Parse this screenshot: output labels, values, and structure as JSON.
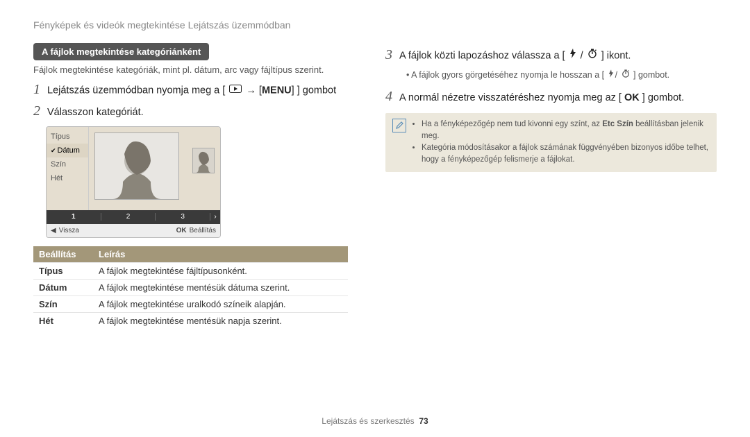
{
  "header": {
    "title": "Fényképek és videók megtekintése Lejátszás üzemmódban"
  },
  "left": {
    "section_title": "A fájlok megtekintése kategóriánként",
    "section_desc": "Fájlok megtekintése kategóriák, mint pl. dátum, arc vagy fájltípus szerint.",
    "step1_pre": "Lejátszás üzemmódban nyomja meg a [",
    "step1_post": "] gombot",
    "step2_text": "Válasszon kategóriát.",
    "screen": {
      "cats": {
        "typus": "Típus",
        "datum": "Dátum",
        "szin": "Szín",
        "het": "Hét"
      },
      "thumbs": {
        "n1": "1",
        "n2": "2",
        "n3": "3"
      },
      "status_back": "Vissza",
      "status_ok": "OK",
      "status_set": "Beállítás"
    },
    "table": {
      "h_setting": "Beállítás",
      "h_desc": "Leírás",
      "r_type": "Típus",
      "r_type_desc": "A fájlok megtekintése fájltípusonként.",
      "r_date": "Dátum",
      "r_date_desc": "A fájlok megtekintése mentésük dátuma szerint.",
      "r_color": "Szín",
      "r_color_desc": "A fájlok megtekintése uralkodó színeik alapján.",
      "r_week": "Hét",
      "r_week_desc": "A fájlok megtekintése mentésük napja szerint."
    }
  },
  "right": {
    "step3_pre": "A fájlok közti lapozáshoz válassza a [",
    "step3_post": "] ikont.",
    "step3_bullet_pre": "A fájlok gyors görgetéséhez nyomja le hosszan a [",
    "step3_bullet_post": "] gombot.",
    "step4_pre": "A normál nézetre visszatéréshez nyomja meg az [",
    "step4_post": "] gombot.",
    "note1_pre": "Ha a fényképezőgép nem tud kivonni egy színt, az ",
    "note1_bold": "Etc Szín",
    "note1_post": " beállításban jelenik meg.",
    "note2": "Kategória módosításakor a fájlok számának függvényében bizonyos időbe telhet, hogy a fényképezőgép felismerje a fájlokat."
  },
  "footer": {
    "section": "Lejátszás és szerkesztés",
    "page": "73"
  },
  "icons": {
    "play": "play-mode-icon",
    "menu": "MENU",
    "flash": "flash-icon",
    "timer": "timer-icon",
    "ok": "OK",
    "back_arrow": "◀",
    "right_arrow": "›",
    "note": "✎"
  }
}
